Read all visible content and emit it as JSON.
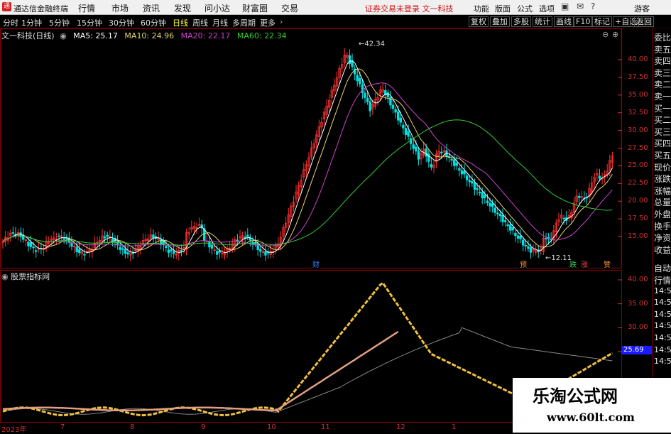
{
  "menubar": {
    "logo_glyph": "通",
    "app_title": "通达信金融终端",
    "items": [
      "行情",
      "市场",
      "资讯",
      "发现",
      "问小达",
      "财富圈",
      "交易"
    ],
    "notice": "证券交易未登录  文一科技",
    "tools": [
      "功能",
      "版面",
      "公式",
      "选项"
    ],
    "user": "游客"
  },
  "periods": {
    "items": [
      "分时",
      "1分钟",
      "5分钟",
      "15分钟",
      "30分钟",
      "60分钟",
      "日线",
      "周线",
      "月线",
      "多周期",
      "更多"
    ],
    "active": "日线",
    "right_buttons": [
      "复权",
      "叠加",
      "多股",
      "统计",
      "画线",
      "F10",
      "标记",
      "+自选",
      "返回"
    ]
  },
  "main": {
    "stock_title": "文一科技(日线)",
    "ma5": "MA5: 25.17",
    "ma10": "MA10: 24.96",
    "ma20": "MA20: 22.17",
    "ma60": "MA60: 22.34",
    "high_label": "42.34",
    "low_label": "12.11",
    "y_ticks": [
      "40.00",
      "37.50",
      "35.00",
      "32.50",
      "30.00",
      "27.50",
      "25.00",
      "22.50",
      "20.00",
      "17.50",
      "15.00"
    ],
    "markers": [
      {
        "text": "财",
        "color": "#3a78ff"
      },
      {
        "text": "预",
        "color": "#ff8c2a"
      },
      {
        "text": "跌",
        "color": "#33cc55"
      },
      {
        "text": "涨",
        "color": "#ff4444"
      },
      {
        "text": "赞",
        "color": "#ff8c2a"
      }
    ]
  },
  "sub": {
    "title": "股票指标网",
    "y_ticks": [
      "40.00",
      "35.00",
      "30.00",
      "25.00"
    ],
    "latest_value": "25.69"
  },
  "dates": [
    "2023年",
    "7",
    "8",
    "9",
    "10",
    "11",
    "12",
    "1"
  ],
  "sidebar": {
    "items": [
      "委比",
      "卖五",
      "卖四",
      "卖三",
      "卖二",
      "卖一",
      "买一",
      "买二",
      "买三",
      "买四",
      "买五",
      "现价",
      "涨跌",
      "涨幅",
      "总量",
      "外盘",
      "换手",
      "净资",
      "收益",
      "自动",
      "行情",
      "14:50",
      "14:50",
      "14:50",
      "14:50",
      "14:50",
      "14:50",
      "14:50"
    ]
  },
  "watermark": {
    "line1": "乐淘公式网",
    "line2": "www.60lt.com"
  },
  "colors": {
    "up": "#ff3030",
    "down": "#00e0e0",
    "ma5": "#ffffff",
    "ma10": "#e6d270",
    "ma20": "#cc44cc",
    "ma60": "#33cc33",
    "accent": "#d41f1f"
  }
}
